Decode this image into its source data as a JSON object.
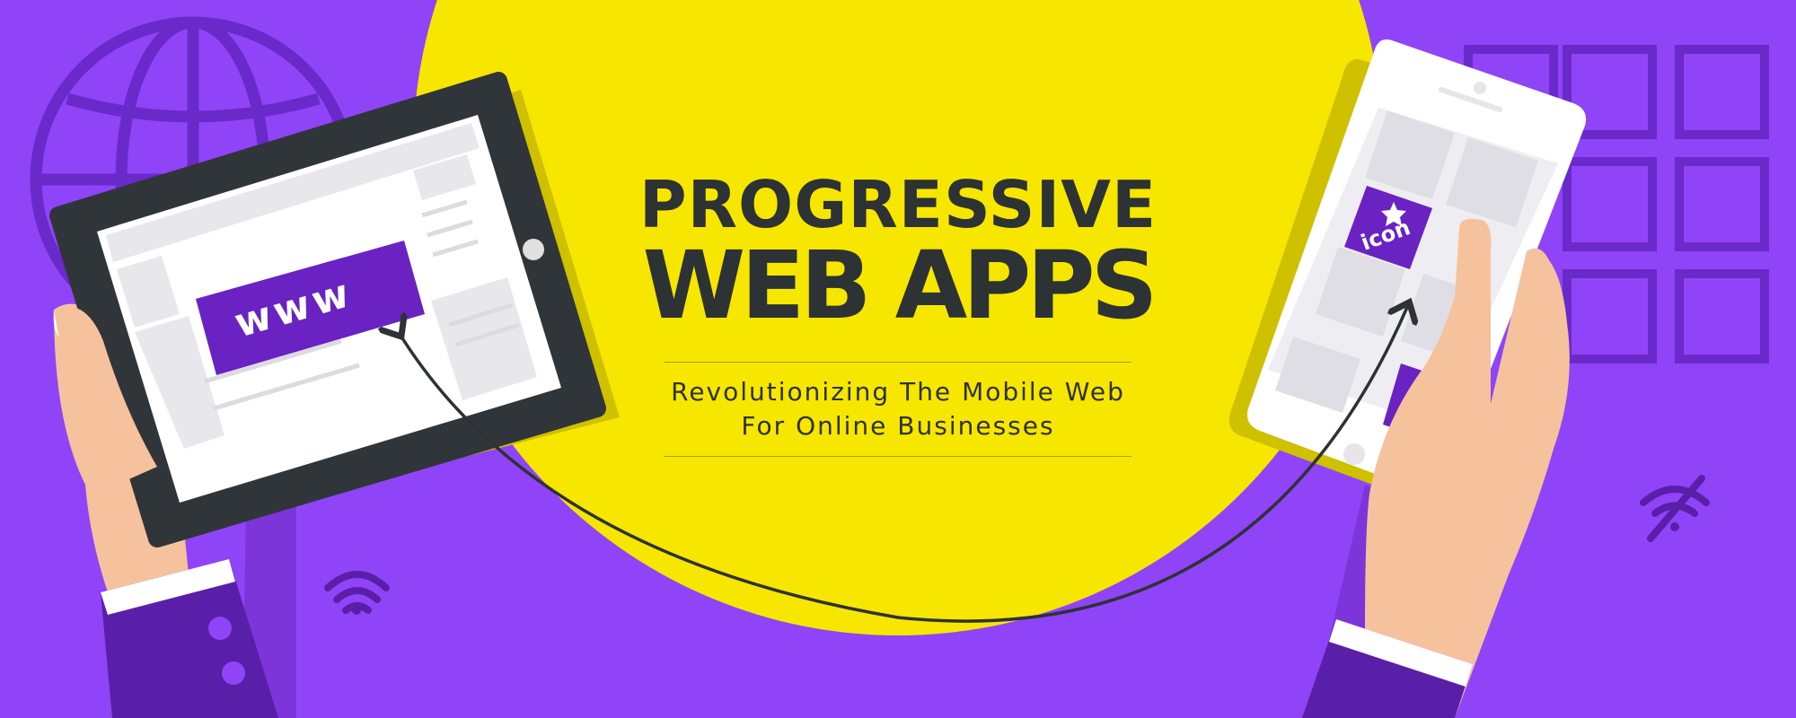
{
  "banner": {
    "title_line1": "PROGRESSIVE",
    "title_line2": "WEB APPS",
    "subtitle_line1": "Revolutionizing The Mobile Web",
    "subtitle_line2": "For Online Businesses"
  },
  "tablet": {
    "url_label": "www"
  },
  "phone": {
    "icon_label": "icon"
  },
  "colors": {
    "background": "#8f45f7",
    "circle": "#f7e700",
    "accent_purple": "#6a22c2",
    "dark_purple": "#5a1fa8",
    "device_frame": "#2f3538",
    "skin": "#f5c29d",
    "text": "#2d3234"
  },
  "icons": [
    "globe-icon",
    "grid-icon",
    "wifi-icon",
    "wifi-off-icon",
    "star-icon",
    "arrow-icon"
  ]
}
